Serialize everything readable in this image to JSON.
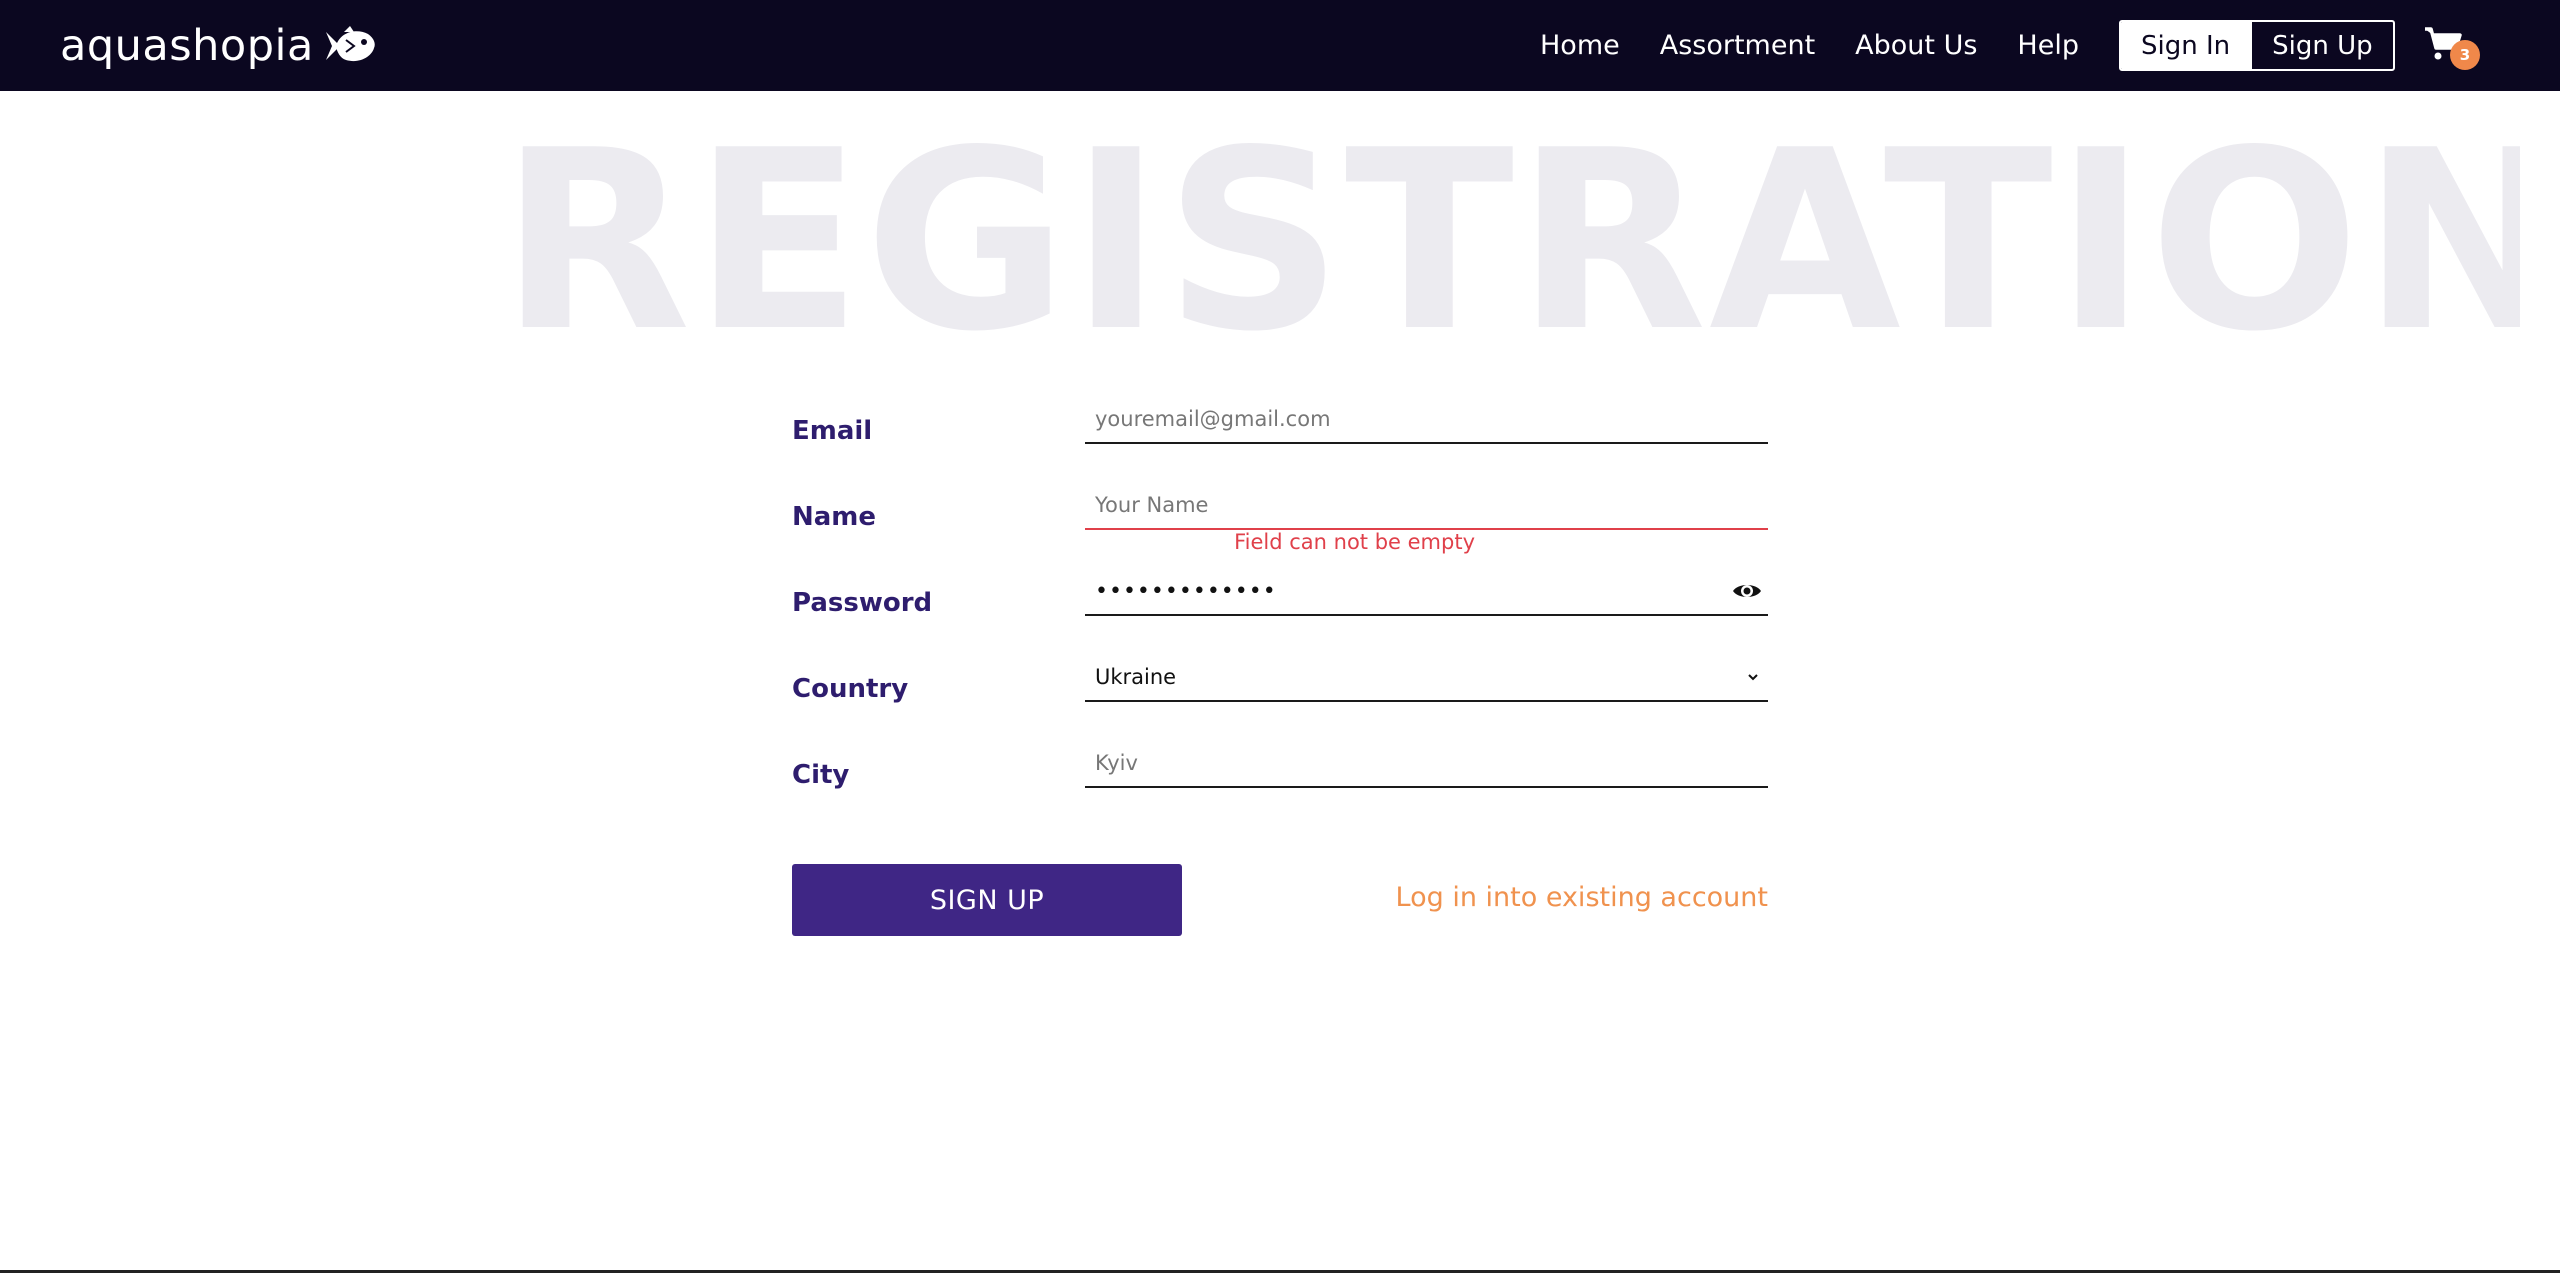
{
  "header": {
    "logo_text": "aquashopia",
    "nav": [
      "Home",
      "Assortment",
      "About Us",
      "Help"
    ],
    "sign_in": "Sign In",
    "sign_up": "Sign Up",
    "cart_count": "3"
  },
  "page": {
    "heading": "REGISTRATION"
  },
  "form": {
    "email": {
      "label": "Email",
      "placeholder": "youremail@gmail.com",
      "value": ""
    },
    "name": {
      "label": "Name",
      "placeholder": "Your Name",
      "value": "",
      "error": "Field can not be empty"
    },
    "password": {
      "label": "Password",
      "masked_value": "•••••••••••••"
    },
    "country": {
      "label": "Country",
      "selected": "Ukraine"
    },
    "city": {
      "label": "City",
      "placeholder": "Kyiv",
      "value": ""
    },
    "submit_label": "SIGN UP",
    "login_link": "Log in into existing account"
  },
  "colors": {
    "header_bg": "#0b0720",
    "label": "#2e1d6e",
    "button": "#3f2685",
    "accent": "#f0924e",
    "error": "#e0404a",
    "heading_watermark": "#ecebf0"
  },
  "icons": {
    "logo": "fish-icon",
    "cart": "cart-icon",
    "password_toggle": "eye-icon",
    "select": "chevron-down-icon"
  }
}
